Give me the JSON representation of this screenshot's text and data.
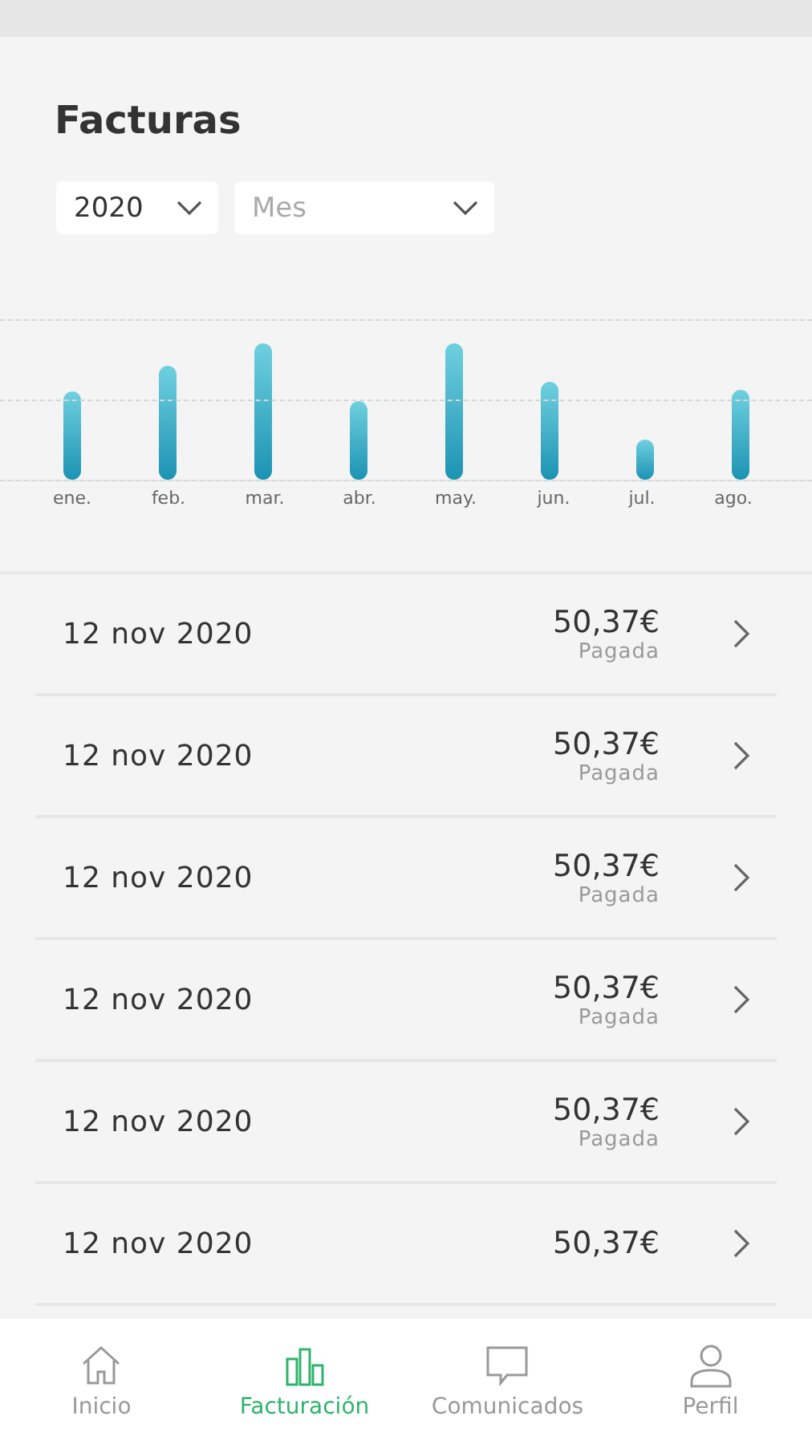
{
  "title": "Facturas",
  "filters": [
    {
      "value": "2020"
    },
    {
      "placeholder": "Mes"
    }
  ],
  "chart": {
    "months": [
      "ene.",
      "feb.",
      "mar.",
      "abr.",
      "may.",
      "jun.",
      "jul.",
      "ago."
    ]
  },
  "invoices": [
    {
      "date": "12 nov 2020",
      "amount": "50,37€",
      "status": "Pagada"
    },
    {
      "date": "12 nov 2020",
      "amount": "50,37€",
      "status": "Pagada"
    },
    {
      "date": "12 nov 2020",
      "amount": "50,37€",
      "status": "Pagada"
    },
    {
      "date": "12 nov 2020",
      "amount": "50,37€",
      "status": "Pagada"
    },
    {
      "date": "12 nov 2020",
      "amount": "50,37€",
      "status": "Pagada"
    },
    {
      "date": "12 nov 2020",
      "amount": "50,37€"
    }
  ],
  "nav": [
    {
      "label": "Inicio",
      "selected": false
    },
    {
      "label": "Facturación",
      "selected": true
    },
    {
      "label": "Comunicados",
      "selected": false
    },
    {
      "label": "Perfil",
      "selected": false
    }
  ]
}
